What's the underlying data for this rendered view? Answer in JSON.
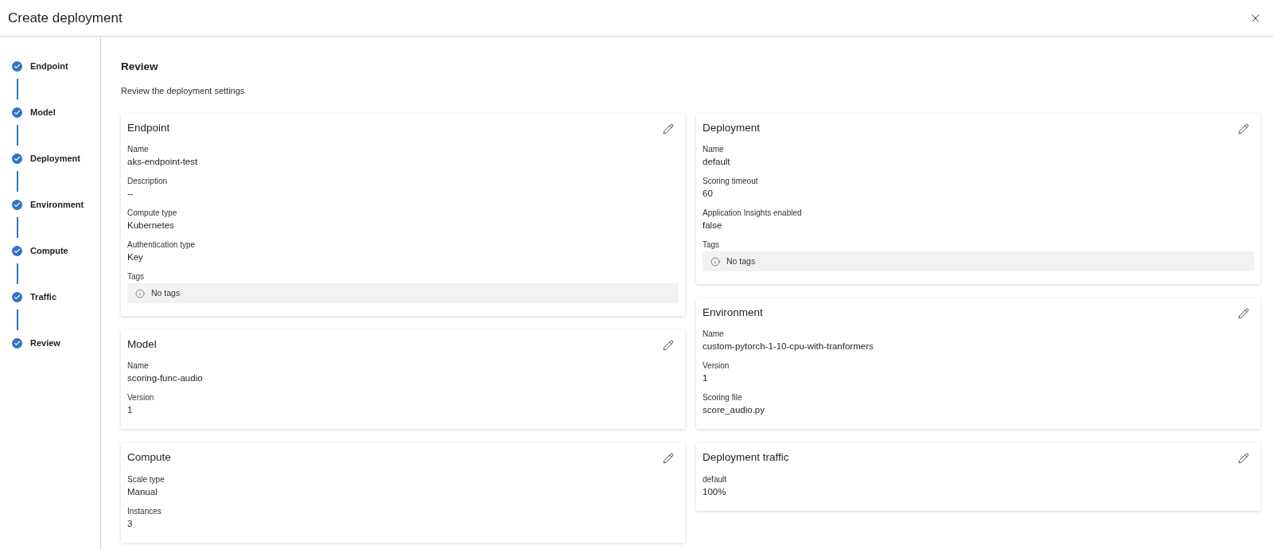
{
  "window": {
    "title": "Create deployment"
  },
  "steps": [
    {
      "label": "Endpoint",
      "completed": true
    },
    {
      "label": "Model",
      "completed": true
    },
    {
      "label": "Deployment",
      "completed": true
    },
    {
      "label": "Environment",
      "completed": true
    },
    {
      "label": "Compute",
      "completed": true
    },
    {
      "label": "Traffic",
      "completed": true
    },
    {
      "label": "Review",
      "completed": true
    }
  ],
  "page": {
    "title": "Review",
    "subtitle": "Review the deployment settings"
  },
  "columns": [
    [
      {
        "title": "Endpoint",
        "fields": [
          {
            "kind": "text",
            "label": "Name",
            "value": "aks-endpoint-test"
          },
          {
            "kind": "text",
            "label": "Description",
            "value": "--"
          },
          {
            "kind": "text",
            "label": "Compute type",
            "value": "Kubernetes"
          },
          {
            "kind": "text",
            "label": "Authentication type",
            "value": "Key"
          },
          {
            "kind": "tags",
            "label": "Tags",
            "value": "No tags"
          }
        ]
      },
      {
        "title": "Model",
        "fields": [
          {
            "kind": "text",
            "label": "Name",
            "value": "scoring-func-audio"
          },
          {
            "kind": "text",
            "label": "Version",
            "value": "1"
          }
        ]
      },
      {
        "title": "Compute",
        "fields": [
          {
            "kind": "text",
            "label": "Scale type",
            "value": "Manual"
          },
          {
            "kind": "text",
            "label": "Instances",
            "value": "3"
          }
        ]
      }
    ],
    [
      {
        "title": "Deployment",
        "fields": [
          {
            "kind": "text",
            "label": "Name",
            "value": "default"
          },
          {
            "kind": "text",
            "label": "Scoring timeout",
            "value": "60"
          },
          {
            "kind": "text",
            "label": "Application Insights enabled",
            "value": "false"
          },
          {
            "kind": "tags",
            "label": "Tags",
            "value": "No tags"
          }
        ]
      },
      {
        "title": "Environment",
        "fields": [
          {
            "kind": "text",
            "label": "Name",
            "value": "custom-pytorch-1-10-cpu-with-tranformers"
          },
          {
            "kind": "text",
            "label": "Version",
            "value": "1"
          },
          {
            "kind": "text",
            "label": "Scoring file",
            "value": "score_audio.py"
          }
        ]
      },
      {
        "title": "Deployment traffic",
        "fields": [
          {
            "kind": "text",
            "label": "default",
            "value": "100%"
          }
        ]
      }
    ]
  ]
}
